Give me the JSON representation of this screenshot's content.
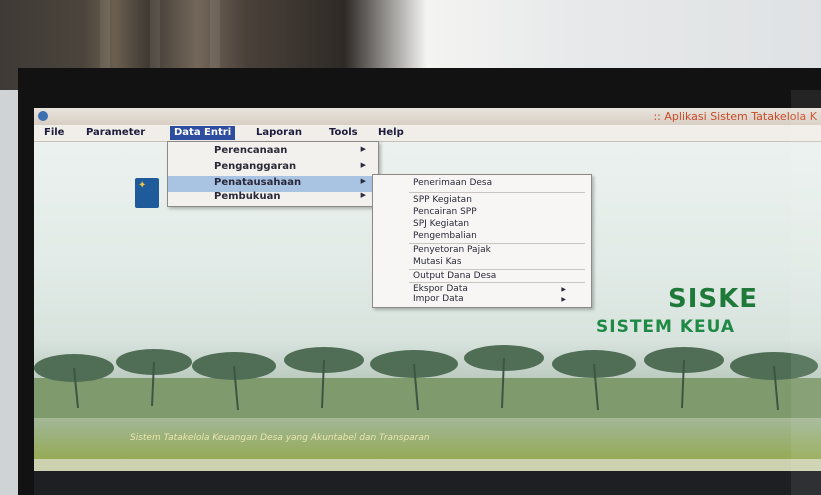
{
  "window": {
    "title": ":: Aplikasi Sistem Tatakelola K"
  },
  "menubar": {
    "items": [
      "File",
      "Parameter",
      "Data Entri",
      "Laporan",
      "Tools",
      "Help"
    ],
    "active": "Data Entri"
  },
  "dropdown": {
    "items": [
      {
        "label": "Perencanaan"
      },
      {
        "label": "Penganggaran"
      },
      {
        "label": "Penatausahaan"
      },
      {
        "label": "Pembukuan"
      }
    ],
    "highlighted": "Penatausahaan"
  },
  "submenu": {
    "items": [
      "Penerimaan Desa",
      "SPP Kegiatan",
      "Pencairan SPP",
      "SPJ Kegiatan",
      "Pengembalian",
      "Penyetoran Pajak",
      "Mutasi Kas",
      "Output Dana Desa",
      "Ekspor Data",
      "Impor Data"
    ]
  },
  "brand": {
    "title": "SISKE",
    "subtitle": "SISTEM KEUA"
  },
  "tagline": "Sistem Tatakelola Keuangan Desa yang Akuntabel dan Transparan",
  "icons": {
    "app": "app-icon",
    "logo": "emblem-icon",
    "submenu_arrow": "triangle-right-icon"
  },
  "colors": {
    "menu_active": "#2d4ea0",
    "highlight": "#a9c3e3",
    "title_text": "#c94b28",
    "brand": "#1f7a3a"
  }
}
